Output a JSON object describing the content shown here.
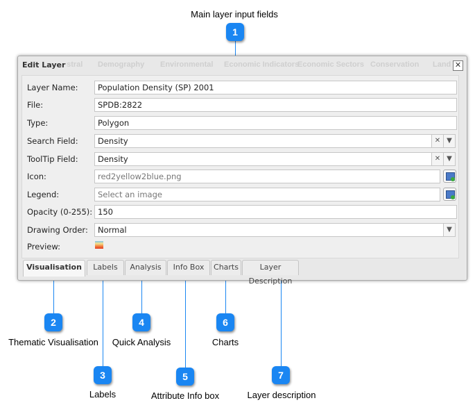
{
  "callouts": {
    "title": "Main layer input fields",
    "items": [
      {
        "num": "1",
        "label": ""
      },
      {
        "num": "2",
        "label": "Thematic Visualisation"
      },
      {
        "num": "3",
        "label": "Labels"
      },
      {
        "num": "4",
        "label": "Quick Analysis"
      },
      {
        "num": "5",
        "label": "Attribute Info box"
      },
      {
        "num": "6",
        "label": "Charts"
      },
      {
        "num": "7",
        "label": "Layer description"
      }
    ],
    "color": "#1a86f2"
  },
  "dialog": {
    "title": "Edit Layer",
    "background_tabs": [
      "astral",
      "Demography",
      "Environmental",
      "Economic Indicators",
      "Economic Sectors",
      "Conservation",
      "Land"
    ],
    "close_icon": "close-icon",
    "fields": [
      {
        "label": "Layer Name:",
        "value": "Population Density (SP) 2001"
      },
      {
        "label": "File:",
        "value": "SPDB:2822"
      },
      {
        "label": "Type:",
        "value": "Polygon"
      },
      {
        "label": "Search Field:",
        "value": "Density"
      },
      {
        "label": "ToolTip Field:",
        "value": "Density"
      },
      {
        "label": "Icon:",
        "value": "red2yellow2blue.png"
      },
      {
        "label": "Legend:",
        "placeholder": "Select an image"
      },
      {
        "label": "Opacity (0-255):",
        "value": "150"
      },
      {
        "label": "Drawing Order:",
        "value": "Normal"
      },
      {
        "label": "Preview:"
      }
    ],
    "tabs": [
      {
        "label": "Visualisation",
        "active": true
      },
      {
        "label": "Labels"
      },
      {
        "label": "Analysis"
      },
      {
        "label": "Info Box"
      },
      {
        "label": "Charts"
      },
      {
        "label": "Layer Description"
      }
    ]
  }
}
